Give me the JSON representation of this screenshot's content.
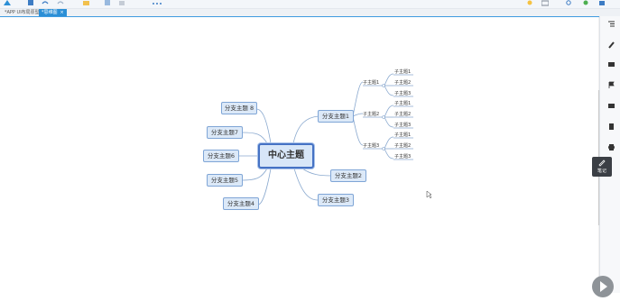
{
  "tabs": [
    {
      "label": "*APP UI布局原型图",
      "active": false
    },
    {
      "label": "*思维图",
      "active": true
    }
  ],
  "mindmap": {
    "center": "中心主题",
    "left_branches": [
      "分支主题 8",
      "分支主题7",
      "分支主题6",
      "分支主题5",
      "分支主题4"
    ],
    "right_branches": [
      "分支主题1",
      "分支主题2",
      "分支主题3"
    ],
    "subtopics": [
      "子主题1",
      "子主题2",
      "子主题3"
    ],
    "leaves": [
      "子主题1",
      "子主题2",
      "子主题3",
      "子主题1",
      "子主题2",
      "子主题3",
      "子主题1",
      "子主题2",
      "子主题3"
    ]
  },
  "tooltip_label": "笔记",
  "colors": {
    "accent": "#2b8fd6",
    "node_fill": "#dce9f8",
    "node_border": "#7fa5d6",
    "line": "#8aa9cf"
  }
}
